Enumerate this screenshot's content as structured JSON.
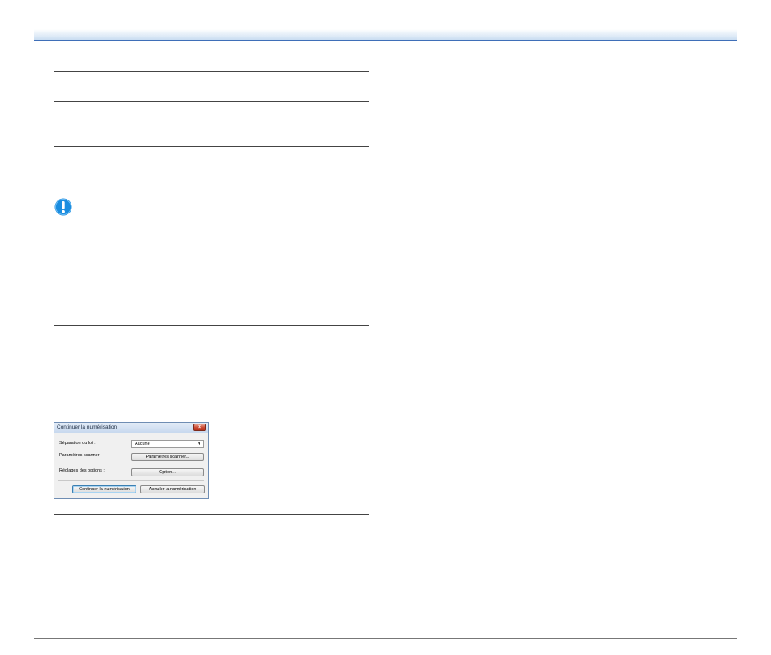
{
  "icons": {
    "important": "important-exclamation-icon"
  },
  "colors": {
    "accent": "#3f6fb8",
    "icon_blue": "#1a8de0"
  },
  "dialog": {
    "title": "Continuer la numérisation",
    "close_label": "×",
    "batch_separation_label": "Séparation du lot :",
    "batch_separation_value": "Aucune",
    "scanner_settings_label": "Paramètres scanner",
    "scanner_settings_button": "Paramètres scanner...",
    "option_settings_label": "Réglages des options :",
    "option_button": "Option...",
    "continue_button": "Continuer la numérisation",
    "cancel_button": "Annuler la numérisation"
  }
}
